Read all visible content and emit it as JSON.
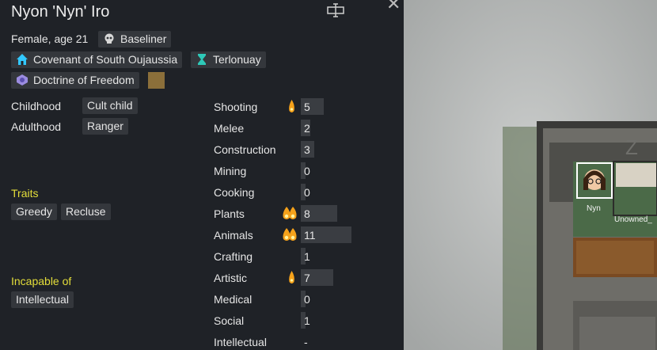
{
  "pawn": {
    "name": "Nyon 'Nyn' Iro",
    "gender_age": "Female, age 21",
    "xenotype": "Baseliner",
    "faction": "Covenant of South Oujaussia",
    "title": "Terlonuay",
    "ideology": "Doctrine of Freedom"
  },
  "backstory": {
    "childhood_label": "Childhood",
    "childhood_value": "Cult child",
    "adulthood_label": "Adulthood",
    "adulthood_value": "Ranger"
  },
  "traits": {
    "heading": "Traits",
    "items": [
      "Greedy",
      "Recluse"
    ]
  },
  "incapable": {
    "heading": "Incapable of",
    "items": [
      "Intellectual"
    ]
  },
  "skills": [
    {
      "name": "Shooting",
      "value": "5",
      "level": 5,
      "passion": 1
    },
    {
      "name": "Melee",
      "value": "2",
      "level": 2,
      "passion": 0
    },
    {
      "name": "Construction",
      "value": "3",
      "level": 3,
      "passion": 0
    },
    {
      "name": "Mining",
      "value": "0",
      "level": 0,
      "passion": 0
    },
    {
      "name": "Cooking",
      "value": "0",
      "level": 0,
      "passion": 0
    },
    {
      "name": "Plants",
      "value": "8",
      "level": 8,
      "passion": 2
    },
    {
      "name": "Animals",
      "value": "11",
      "level": 11,
      "passion": 2
    },
    {
      "name": "Crafting",
      "value": "1",
      "level": 1,
      "passion": 0
    },
    {
      "name": "Artistic",
      "value": "7",
      "level": 7,
      "passion": 1
    },
    {
      "name": "Medical",
      "value": "0",
      "level": 0,
      "passion": 0
    },
    {
      "name": "Social",
      "value": "1",
      "level": 1,
      "passion": 0
    },
    {
      "name": "Intellectual",
      "value": "-",
      "level": 0,
      "passion": 0
    }
  ],
  "map": {
    "pawn_label": "Nyn",
    "other_label": "Unowned_"
  },
  "colors": {
    "faction": "#32c8ff",
    "title": "#2ec9b8",
    "ideology_swatch": "#8b6f3a",
    "passion": "#f6a21a"
  }
}
